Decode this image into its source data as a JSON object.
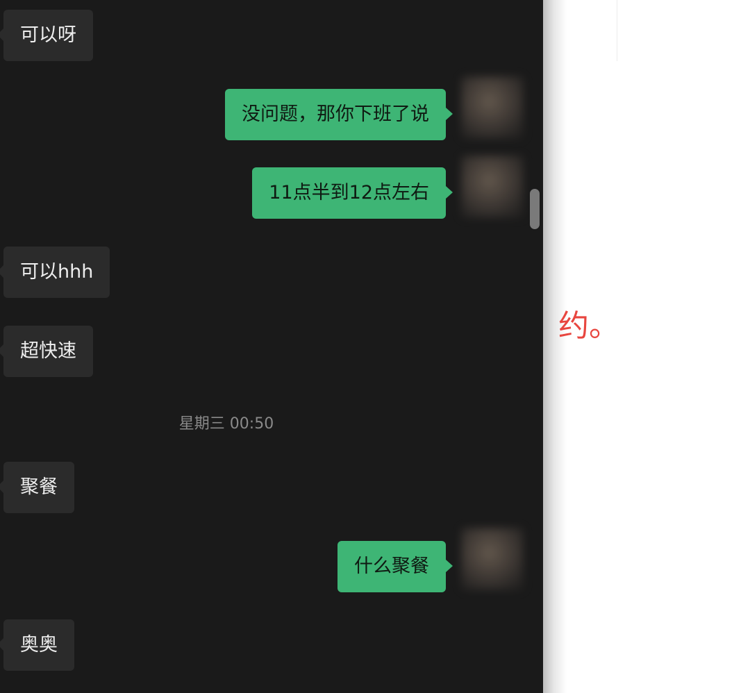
{
  "chat": {
    "messages": [
      {
        "direction": "incoming",
        "text": "可以呀"
      },
      {
        "direction": "outgoing",
        "text": "没问题，那你下班了说"
      },
      {
        "direction": "outgoing",
        "text": "11点半到12点左右"
      },
      {
        "direction": "incoming",
        "text": "可以hhh"
      },
      {
        "direction": "incoming",
        "text": "超快速"
      },
      {
        "direction": "incoming",
        "text": "聚餐"
      },
      {
        "direction": "outgoing",
        "text": "什么聚餐"
      },
      {
        "direction": "incoming",
        "text": "奥奥"
      }
    ],
    "timestamp": "星期三 00:50"
  },
  "right_page": {
    "text": "约。",
    "text_color": "#e8463f"
  },
  "colors": {
    "chat_background": "#1a1a1a",
    "incoming_bubble": "#2b2b2b",
    "outgoing_bubble": "#3eb575"
  }
}
